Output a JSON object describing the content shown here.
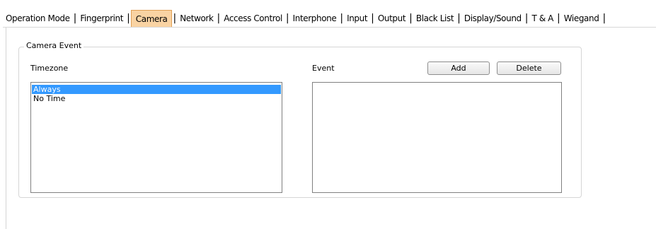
{
  "tabs": [
    {
      "label": "Operation Mode",
      "active": false
    },
    {
      "label": "Fingerprint",
      "active": false
    },
    {
      "label": "Camera",
      "active": true
    },
    {
      "label": "Network",
      "active": false
    },
    {
      "label": "Access Control",
      "active": false
    },
    {
      "label": "Interphone",
      "active": false
    },
    {
      "label": "Input",
      "active": false
    },
    {
      "label": "Output",
      "active": false
    },
    {
      "label": "Black List",
      "active": false
    },
    {
      "label": "Display/Sound",
      "active": false
    },
    {
      "label": "T & A",
      "active": false
    },
    {
      "label": "Wiegand",
      "active": false
    }
  ],
  "separator": "|",
  "group": {
    "title": "Camera Event",
    "timezone_label": "Timezone",
    "event_label": "Event",
    "timezone_items": [
      {
        "label": "Always",
        "selected": true
      },
      {
        "label": "No Time",
        "selected": false
      }
    ],
    "event_items": [],
    "add_label": "Add",
    "delete_label": "Delete"
  },
  "colors": {
    "active_tab": "#f9d3a3",
    "selection": "#3399ff"
  }
}
